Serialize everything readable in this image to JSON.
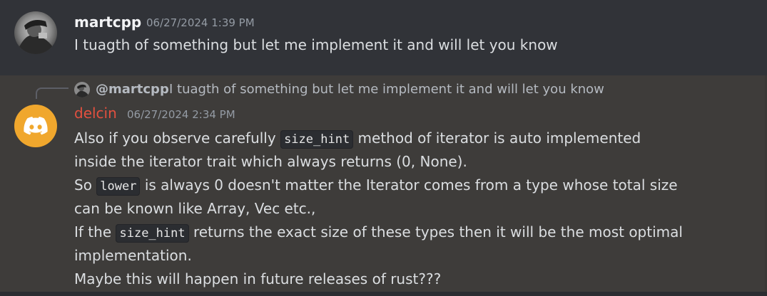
{
  "messages": [
    {
      "author": "martcpp",
      "timestamp": "06/27/2024 1:39 PM",
      "content": "I tuagth of something but let me implement it and will let you know"
    },
    {
      "reply": {
        "mention": "@martcpp",
        "text": "I tuagth of something but let me implement it and will let you know"
      },
      "author": "delcin",
      "author_color": "#e3503f",
      "avatar_color": "#f0a72d",
      "avatar_icon": "discord-logo-icon",
      "timestamp": "06/27/2024 2:34 PM",
      "lines": {
        "l1a": "Also if you observe carefully ",
        "l1code": "size_hint",
        "l1b": " method of iterator is auto implemented",
        "l2": "inside the iterator trait which always returns (0, None).",
        "l3a": "So ",
        "l3code": "lower",
        "l3b": " is always 0 doesn't matter the Iterator comes from a type whose total size",
        "l4": "can be known like Array, Vec etc.,",
        "l5a": "If the ",
        "l5code": "size_hint",
        "l5b": " returns the exact size of these types then it will be the most optimal",
        "l6": "implementation.",
        "l7": "Maybe this will happen in future releases of rust???"
      }
    }
  ]
}
